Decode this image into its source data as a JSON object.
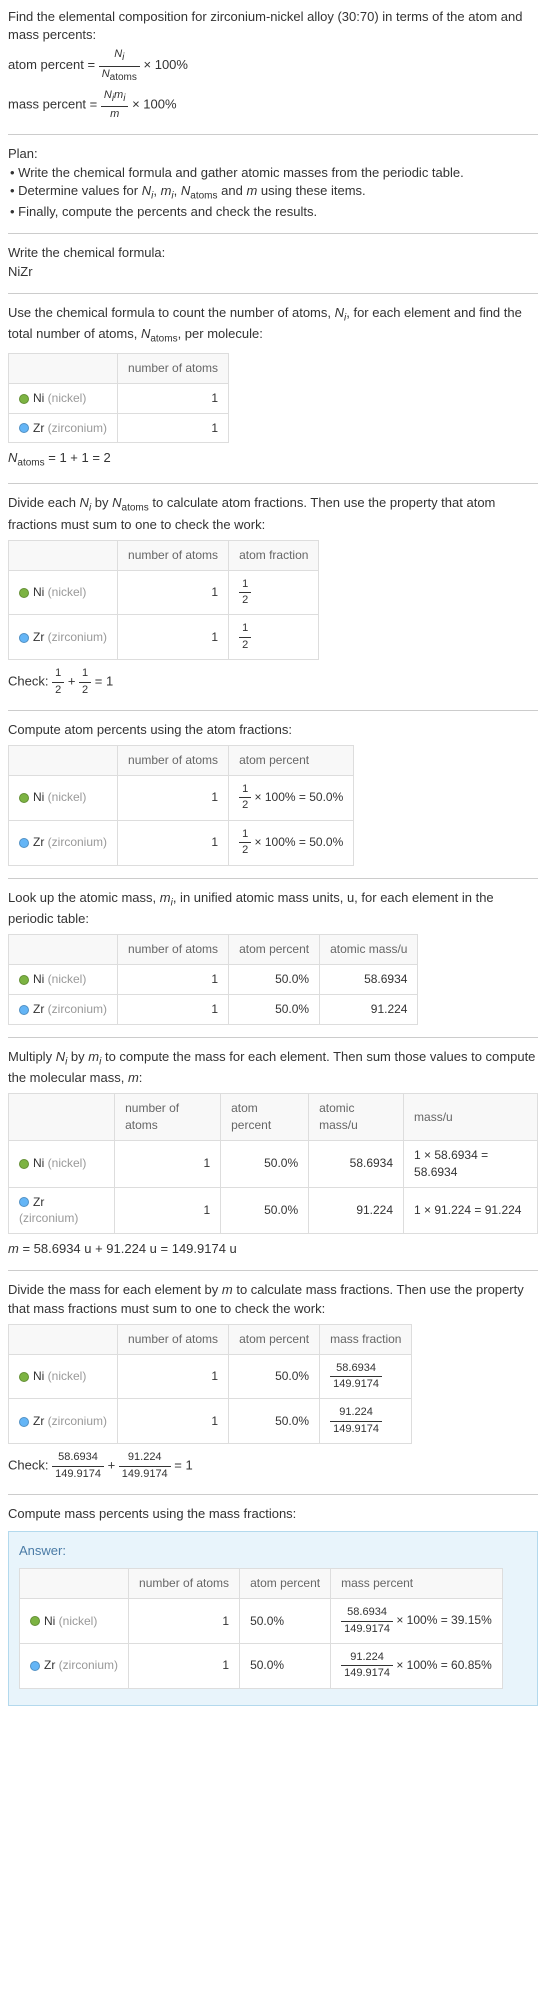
{
  "intro": {
    "line1": "Find the elemental composition for zirconium-nickel alloy (30:70) in terms of the atom and mass percents:",
    "atom_percent_label": "atom percent = ",
    "atom_frac_num": "N_i",
    "atom_frac_den": "N_atoms",
    "times100a": " × 100%",
    "mass_percent_label": "mass percent = ",
    "mass_frac_num": "N_i m_i",
    "mass_frac_den": "m",
    "times100b": " × 100%"
  },
  "plan": {
    "title": "Plan:",
    "b1": "• Write the chemical formula and gather atomic masses from the periodic table.",
    "b2_a": "• Determine values for ",
    "b2_b": " using these items.",
    "b3": "• Finally, compute the percents and check the results."
  },
  "step1": {
    "title": "Write the chemical formula:",
    "formula": "NiZr"
  },
  "step2": {
    "title_a": "Use the chemical formula to count the number of atoms, ",
    "title_b": ", for each element and find the total number of atoms, ",
    "title_c": ", per molecule:",
    "h_blank": "",
    "h_atoms": "number of atoms",
    "ni_label": "Ni ",
    "ni_gray": "(nickel)",
    "ni_atoms": "1",
    "zr_label": "Zr ",
    "zr_gray": "(zirconium)",
    "zr_atoms": "1",
    "natoms_line": "N_atoms = 1 + 1 = 2"
  },
  "step3": {
    "title_a": "Divide each ",
    "title_b": " by ",
    "title_c": " to calculate atom fractions. Then use the property that atom fractions must sum to one to check the work:",
    "h_frac": "atom fraction",
    "ni_frac_num": "1",
    "ni_frac_den": "2",
    "zr_frac_num": "1",
    "zr_frac_den": "2",
    "check_label": "Check: ",
    "check_eq": " = 1"
  },
  "step4": {
    "title": "Compute atom percents using the atom fractions:",
    "h_pct": "atom percent",
    "ni_pct": " × 100% = 50.0%",
    "zr_pct": " × 100% = 50.0%"
  },
  "step5": {
    "title_a": "Look up the atomic mass, ",
    "title_b": ", in unified atomic mass units, u, for each element in the periodic table:",
    "h_mass": "atomic mass/u",
    "ni_pct_v": "50.0%",
    "zr_pct_v": "50.0%",
    "ni_mass": "58.6934",
    "zr_mass": "91.224"
  },
  "step6": {
    "title_a": "Multiply ",
    "title_b": " by ",
    "title_c": " to compute the mass for each element. Then sum those values to compute the molecular mass, ",
    "title_d": ":",
    "h_massu": "mass/u",
    "ni_calc": "1 × 58.6934 = 58.6934",
    "zr_calc": "1 × 91.224 = 91.224",
    "m_line": "m = 58.6934 u + 91.224 u = 149.9174 u"
  },
  "step7": {
    "title_a": "Divide the mass for each element by ",
    "title_b": " to calculate mass fractions. Then use the property that mass fractions must sum to one to check the work:",
    "h_mfrac": "mass fraction",
    "ni_mf_num": "58.6934",
    "ni_mf_den": "149.9174",
    "zr_mf_num": "91.224",
    "zr_mf_den": "149.9174",
    "check_eq": " = 1"
  },
  "step8": {
    "title": "Compute mass percents using the mass fractions:",
    "answer": "Answer:",
    "h_mpct": "mass percent",
    "ni_mp_num": "58.6934",
    "ni_mp_den": "149.9174",
    "ni_mp_rest": " × 100% = 39.15%",
    "zr_mp_num": "91.224",
    "zr_mp_den": "149.9174",
    "zr_mp_rest": " × 100% = 60.85%"
  },
  "vars": {
    "Ni": "N",
    "i": "i",
    "Natoms": "N",
    "atoms": "atoms",
    "m": "m",
    "mi": "m"
  }
}
